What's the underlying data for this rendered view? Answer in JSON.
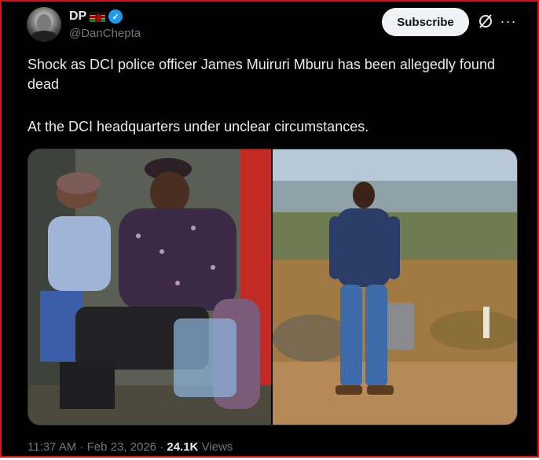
{
  "author": {
    "name": "DP",
    "handle": "@DanChepta"
  },
  "actions": {
    "subscribe_label": "Subscribe"
  },
  "post": {
    "text_line1": "Shock as DCI police officer James Muiruri Mburu has been allegedly found dead",
    "text_line2": "At the DCI headquarters under unclear circumstances."
  },
  "meta": {
    "time": "11:37 AM",
    "separator1": "·",
    "date": "Feb 23, 2026",
    "separator2": "·",
    "views_count": "24.1K",
    "views_label": "Views"
  },
  "icons": {
    "verified": "verified-badge-icon",
    "flag": "kenya-flag-icon",
    "grok": "grok-icon",
    "more": "more-icon"
  },
  "colors": {
    "background": "#000000",
    "text": "#e7e9ea",
    "secondary": "#71767b",
    "verified": "#1d9bf0",
    "subscribe_bg": "#eff3f4",
    "frame_border": "#e01010"
  }
}
